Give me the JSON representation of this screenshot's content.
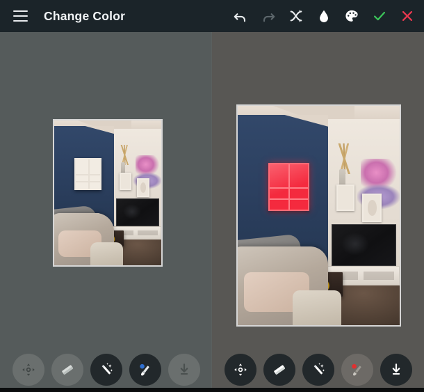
{
  "app": {
    "title": "Change Color",
    "background_color": "#585d5c",
    "header_color": "#1b2429"
  },
  "header": {
    "menu_icon": "hamburger-menu-icon",
    "title": "Change Color",
    "actions": [
      {
        "name": "undo",
        "icon": "undo-arrow-icon",
        "label": "Undo",
        "state": "enabled",
        "color": "#e8ebed"
      },
      {
        "name": "redo",
        "icon": "redo-arrow-icon",
        "label": "Redo",
        "state": "disabled",
        "color": "#5d676c"
      },
      {
        "name": "shuffle",
        "icon": "shuffle-icon",
        "label": "Shuffle",
        "state": "enabled",
        "color": "#e8ebed"
      },
      {
        "name": "fill",
        "icon": "paint-drop-icon",
        "label": "Fill",
        "state": "enabled",
        "color": "#ffffff"
      },
      {
        "name": "palette",
        "icon": "color-palette-icon",
        "label": "Palette",
        "state": "enabled",
        "color": "#ffffff"
      },
      {
        "name": "confirm",
        "icon": "checkmark-icon",
        "label": "Apply",
        "state": "enabled",
        "color": "#3cc65a"
      },
      {
        "name": "cancel",
        "icon": "close-x-icon",
        "label": "Cancel",
        "state": "enabled",
        "color": "#e8384f"
      }
    ]
  },
  "panes": {
    "left": {
      "label": "Before preview",
      "photo": {
        "alt": "Living room with blue accent wall and white wall shelf",
        "shelf_color": "#f2ece3",
        "wall_color": "#2d4260"
      }
    },
    "right": {
      "label": "After preview",
      "photo": {
        "alt": "Living room with blue accent wall and red recolored wall shelf",
        "shelf_color": "#f42a3e",
        "wall_color": "#2d4260"
      }
    }
  },
  "toolbar_left": {
    "tools": [
      {
        "name": "move",
        "icon": "move-arrows-icon",
        "label": "Move",
        "state": "dimmed"
      },
      {
        "name": "eraser",
        "icon": "eraser-icon",
        "label": "Eraser",
        "state": "dimmed"
      },
      {
        "name": "magic-wand",
        "icon": "magic-wand-icon",
        "label": "Magic Wand",
        "state": "active"
      },
      {
        "name": "brush",
        "icon": "paint-brush-icon",
        "label": "Brush",
        "state": "active",
        "badge_color": "#2f6fd0"
      },
      {
        "name": "download",
        "icon": "download-icon",
        "label": "Save",
        "state": "dimmed"
      }
    ]
  },
  "toolbar_right": {
    "tools": [
      {
        "name": "move",
        "icon": "move-arrows-icon",
        "label": "Move",
        "state": "active"
      },
      {
        "name": "eraser",
        "icon": "eraser-icon",
        "label": "Eraser",
        "state": "active"
      },
      {
        "name": "magic-wand",
        "icon": "magic-wand-icon",
        "label": "Magic Wand",
        "state": "active"
      },
      {
        "name": "brush",
        "icon": "paint-brush-icon",
        "label": "Brush",
        "state": "dimmed",
        "badge_color": "#e03030"
      },
      {
        "name": "download",
        "icon": "download-icon",
        "label": "Save",
        "state": "active"
      }
    ]
  }
}
